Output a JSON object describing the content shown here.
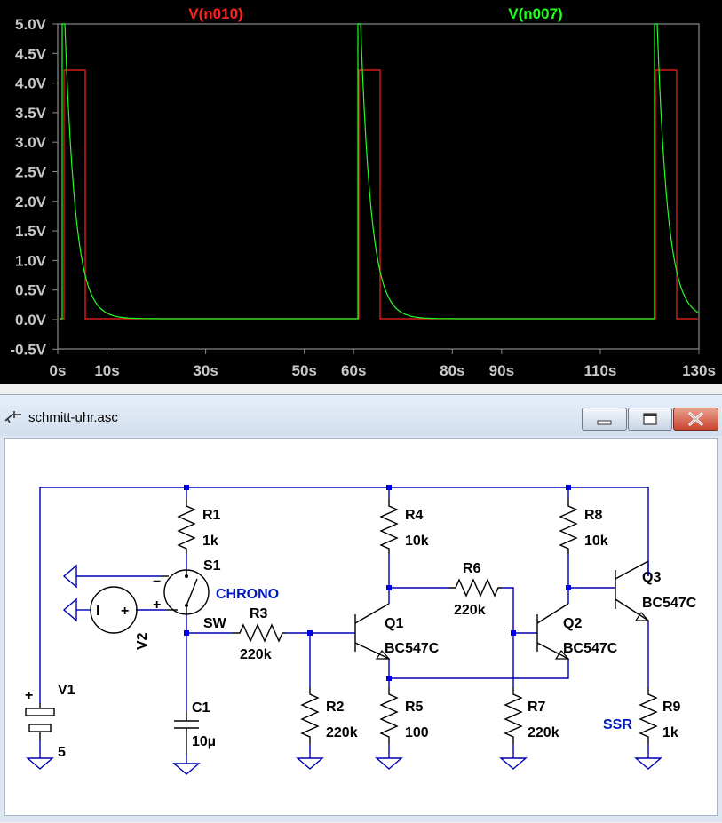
{
  "plot": {
    "traces": [
      {
        "name": "V(n010)",
        "color": "#ff2020"
      },
      {
        "name": "V(n007)",
        "color": "#20ff20"
      }
    ],
    "y_ticks": [
      "5.0V",
      "4.5V",
      "4.0V",
      "3.5V",
      "3.0V",
      "2.5V",
      "2.0V",
      "1.5V",
      "1.0V",
      "0.5V",
      "0.0V",
      "-0.5V"
    ],
    "x_ticks": [
      "0s",
      "10s",
      "30s",
      "50s",
      "60s",
      "80s",
      "90s",
      "110s",
      "130s"
    ]
  },
  "window": {
    "title": "schmitt-uhr.asc",
    "icons": {
      "app": "ltspice-probe-icon",
      "minimize": "minimize-icon",
      "maximize": "maximize-icon",
      "close": "close-icon"
    }
  },
  "schematic": {
    "components": {
      "R1": {
        "name": "R1",
        "value": "1k"
      },
      "R2": {
        "name": "R2",
        "value": "220k"
      },
      "R3": {
        "name": "R3",
        "value": "220k"
      },
      "R4": {
        "name": "R4",
        "value": "10k"
      },
      "R5": {
        "name": "R5",
        "value": "100"
      },
      "R6": {
        "name": "R6",
        "value": "220k"
      },
      "R7": {
        "name": "R7",
        "value": "220k"
      },
      "R8": {
        "name": "R8",
        "value": "10k"
      },
      "R9": {
        "name": "R9",
        "value": "1k"
      },
      "C1": {
        "name": "C1",
        "value": "10µ"
      },
      "V1": {
        "name": "V1",
        "value": "5"
      },
      "V2": {
        "name": "V2"
      },
      "S1": {
        "name": "S1",
        "model": "CHRONO",
        "sub": "SW"
      },
      "Q1": {
        "name": "Q1",
        "model": "BC547C"
      },
      "Q2": {
        "name": "Q2",
        "model": "BC547C"
      },
      "Q3": {
        "name": "Q3",
        "model": "BC547C"
      }
    },
    "net_labels": {
      "ssr": "SSR"
    },
    "v2_signs": {
      "minus": "−",
      "plus": "+",
      "src_minus": "I",
      "src_plus": "+"
    },
    "v1_sign": "+",
    "colors": {
      "wire": "#0000b0",
      "net_label": "#0018c0",
      "junction": "#0000e0"
    }
  }
}
